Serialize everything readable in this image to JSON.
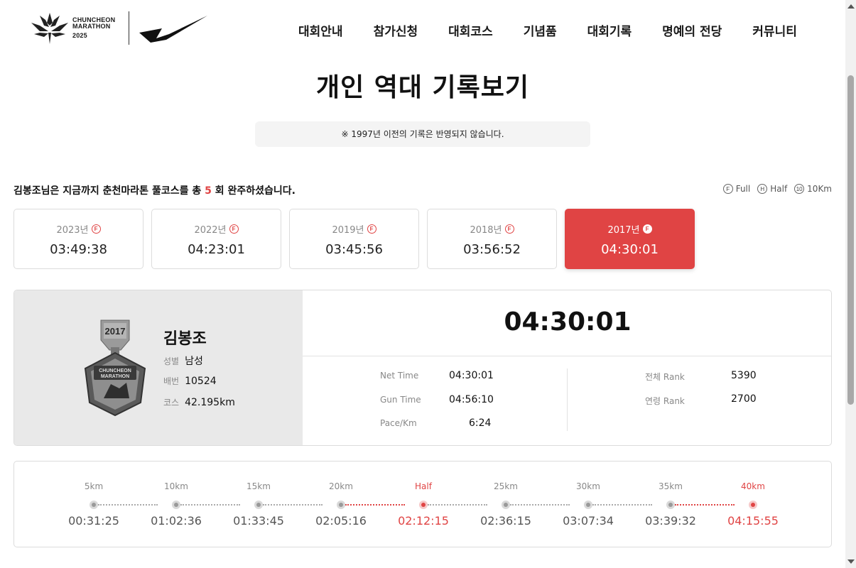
{
  "header": {
    "logo": {
      "line1": "CHUNCHEON",
      "line2": "MARATHON",
      "year": "2025"
    },
    "nav": [
      "대회안내",
      "참가신청",
      "대회코스",
      "기념품",
      "대회기록",
      "명예의 전당",
      "커뮤니티"
    ]
  },
  "title": "개인 역대 기록보기",
  "notice": "※ 1997년 이전의 기록은 반영되지 않습니다.",
  "summary": {
    "prefix": "김봉조님은 지금까지 춘천마라톤 풀코스를 총 ",
    "count": "5",
    "suffix": " 회 완주하셨습니다."
  },
  "legend": [
    {
      "badge": "F",
      "label": "Full"
    },
    {
      "badge": "H",
      "label": "Half"
    },
    {
      "badge": "10",
      "label": "10Km"
    }
  ],
  "records": [
    {
      "year": "2023년",
      "badge": "F",
      "time": "03:49:38",
      "active": false
    },
    {
      "year": "2022년",
      "badge": "F",
      "time": "04:23:01",
      "active": false
    },
    {
      "year": "2019년",
      "badge": "F",
      "time": "03:45:56",
      "active": false
    },
    {
      "year": "2018년",
      "badge": "F",
      "time": "03:56:52",
      "active": false
    },
    {
      "year": "2017년",
      "badge": "F",
      "time": "04:30:01",
      "active": true
    }
  ],
  "detail": {
    "medal_year": "2017",
    "medal_line1": "CHUNCHEON",
    "medal_line2": "MARATHON",
    "name": "김봉조",
    "gender_label": "성별",
    "gender": "남성",
    "bib_label": "배번",
    "bib": "10524",
    "course_label": "코스",
    "course": "42.195km",
    "finish_time": "04:30:01",
    "net_time_label": "Net Time",
    "net_time": "04:30:01",
    "gun_time_label": "Gun Time",
    "gun_time": "04:56:10",
    "pace_label": "Pace/Km",
    "pace": "6:24",
    "overall_rank_label": "전체 Rank",
    "overall_rank": "5390",
    "age_rank_label": "연령 Rank",
    "age_rank": "2700"
  },
  "splits": [
    {
      "label": "5km",
      "time": "00:31:25",
      "highlight": false
    },
    {
      "label": "10km",
      "time": "01:02:36",
      "highlight": false
    },
    {
      "label": "15km",
      "time": "01:33:45",
      "highlight": false
    },
    {
      "label": "20km",
      "time": "02:05:16",
      "highlight": false
    },
    {
      "label": "Half",
      "time": "02:12:15",
      "highlight": true
    },
    {
      "label": "25km",
      "time": "02:36:15",
      "highlight": false
    },
    {
      "label": "30km",
      "time": "03:07:34",
      "highlight": false
    },
    {
      "label": "35km",
      "time": "03:39:32",
      "highlight": false
    },
    {
      "label": "40km",
      "time": "04:15:55",
      "highlight": true
    }
  ],
  "colors": {
    "accent": "#e04444",
    "panel_bg": "#e9e9e9",
    "border": "#dcdcdc"
  }
}
